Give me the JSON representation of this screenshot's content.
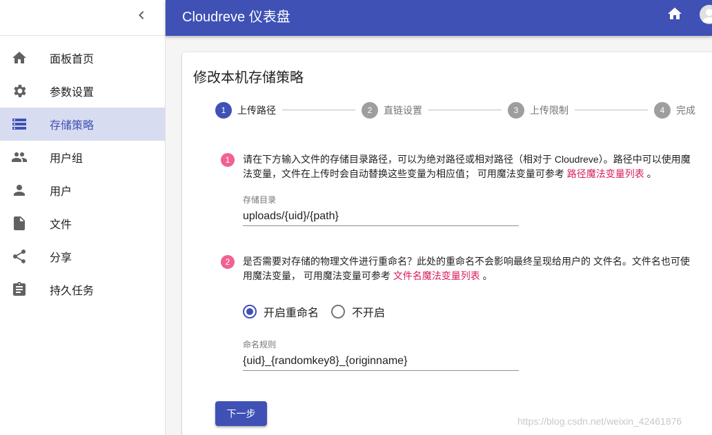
{
  "app": {
    "title": "Cloudreve 仪表盘"
  },
  "sidebar": {
    "items": [
      {
        "label": "面板首页",
        "icon": "home-icon"
      },
      {
        "label": "参数设置",
        "icon": "gear-icon"
      },
      {
        "label": "存储策略",
        "icon": "storage-icon",
        "active": true
      },
      {
        "label": "用户组",
        "icon": "group-icon"
      },
      {
        "label": "用户",
        "icon": "person-icon"
      },
      {
        "label": "文件",
        "icon": "file-icon"
      },
      {
        "label": "分享",
        "icon": "share-icon"
      },
      {
        "label": "持久任务",
        "icon": "task-icon"
      }
    ]
  },
  "card": {
    "title": "修改本机存储策略",
    "steps": [
      {
        "num": "1",
        "label": "上传路径"
      },
      {
        "num": "2",
        "label": "直链设置"
      },
      {
        "num": "3",
        "label": "上传限制"
      },
      {
        "num": "4",
        "label": "完成"
      }
    ],
    "section1": {
      "num": "1",
      "text": "请在下方输入文件的存储目录路径，可以为绝对路径或相对路径（相对于 Cloudreve）。路径中可以使用魔法变量，文件在上传时会自动替换这些变量为相应值； 可用魔法变量可参考 ",
      "link": "路径魔法变量列表",
      "suffix": " 。",
      "field_label": "存储目录",
      "field_value": "uploads/{uid}/{path}"
    },
    "section2": {
      "num": "2",
      "text": "是否需要对存储的物理文件进行重命名？此处的重命名不会影响最终呈现给用户的 文件名。文件名也可使用魔法变量， 可用魔法变量可参考 ",
      "link": "文件名魔法变量列表",
      "suffix": " 。",
      "radio_on": "开启重命名",
      "radio_off": "不开启",
      "field_label": "命名规则",
      "field_value": "{uid}_{randomkey8}_{originname}"
    },
    "next_button": "下一步"
  },
  "watermark": "https://blog.csdn.net/weixin_42461876",
  "colors": {
    "primary": "#3f51b5",
    "accent": "#f06292",
    "link": "#d81b60",
    "active_bg": "#d8dcf0"
  }
}
